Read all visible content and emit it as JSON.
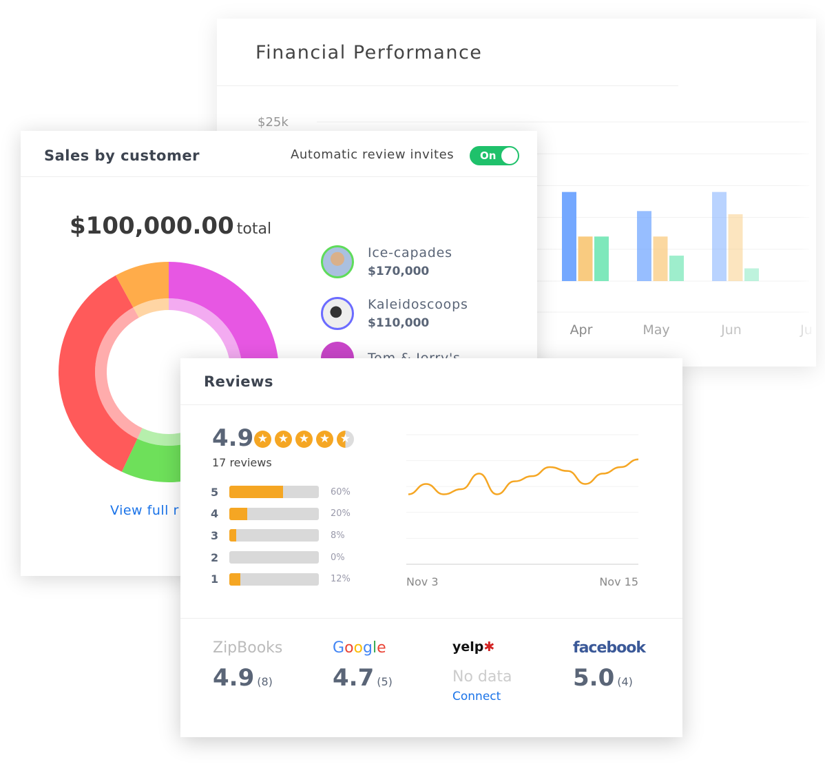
{
  "financial": {
    "title": "Financial Performance",
    "y_label": "$25k"
  },
  "sales": {
    "title": "Sales by customer",
    "auto_label": "Automatic review invites",
    "toggle_label": "On",
    "toggle_on": true,
    "total_value": "$100,000.00",
    "total_suffix": "total",
    "view_link": "View full r",
    "customers": [
      {
        "name": "Ice-capades",
        "amount": "$170,000",
        "ring": "#5fdc5a"
      },
      {
        "name": "Kaleidoscoops",
        "amount": "$110,000",
        "ring": "#6b6bff"
      },
      {
        "name": "Tom & Jerry's",
        "amount": "",
        "ring": "#c945c9"
      }
    ]
  },
  "reviews": {
    "title": "Reviews",
    "rating": "4.9",
    "stars": 4.9,
    "count_label": "17 reviews",
    "breakdown": [
      {
        "star": "5",
        "pct": "60%",
        "value": 60
      },
      {
        "star": "4",
        "pct": "20%",
        "value": 20
      },
      {
        "star": "3",
        "pct": "8%",
        "value": 8
      },
      {
        "star": "2",
        "pct": "0%",
        "value": 0
      },
      {
        "star": "1",
        "pct": "12%",
        "value": 12
      }
    ],
    "sources": [
      {
        "name": "ZipBooks",
        "score": "4.9",
        "count": "(8)"
      },
      {
        "name": "Google",
        "score": "4.7",
        "count": "(5)"
      },
      {
        "name": "yelp",
        "nodata": "No data",
        "connect": "Connect"
      },
      {
        "name": "facebook",
        "score": "5.0",
        "count": "(4)"
      }
    ]
  },
  "chart_data": [
    {
      "type": "bar",
      "categories": [
        "Apr",
        "May",
        "Jun",
        "Jul"
      ],
      "category_labels": [
        "Apr",
        "May",
        "Jun",
        "Ju"
      ],
      "ylim": [
        0,
        25000
      ],
      "y_tick": "$25k",
      "series": [
        {
          "color": "#74a8ff",
          "values": [
            14000,
            11000,
            14000,
            null
          ]
        },
        {
          "color": "#f9cb80",
          "values": [
            7000,
            7000,
            10500,
            null
          ]
        },
        {
          "color": "#7ee8bb",
          "values": [
            7000,
            4000,
            2000,
            null
          ]
        }
      ]
    },
    {
      "type": "pie",
      "donut": true,
      "slices": [
        {
          "color": "#e757e3",
          "value": 46
        },
        {
          "color": "#6ee05a",
          "value": 11
        },
        {
          "color": "#ff5a5a",
          "value": 35
        },
        {
          "color": "#ffac4a",
          "value": 8
        }
      ]
    },
    {
      "type": "line",
      "color": "#f5a623",
      "x_labels": [
        "Nov 3",
        "Nov 15"
      ],
      "ylim": [
        0,
        5
      ],
      "values": [
        2.7,
        3.1,
        2.7,
        2.9,
        3.5,
        2.7,
        3.2,
        3.4,
        3.75,
        3.6,
        3.1,
        3.5,
        3.75,
        4.05
      ]
    }
  ]
}
